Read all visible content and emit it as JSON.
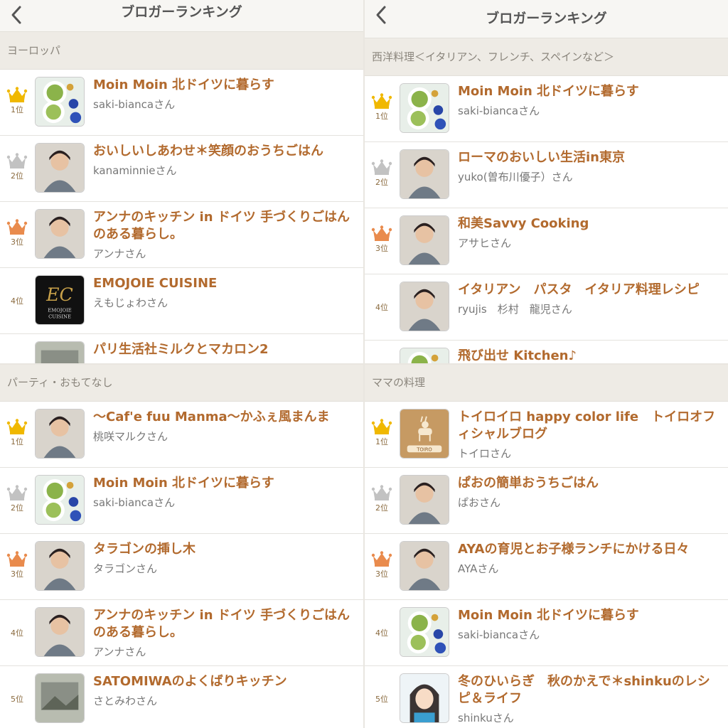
{
  "colors": {
    "gold": "#f0b800",
    "silver": "#c2c2c2",
    "bronze": "#e98b4d",
    "title": "#b26a2e"
  },
  "panels": [
    {
      "header_title": "ブロガーランキング",
      "section": "ヨーロッパ",
      "items": [
        {
          "rank": "1位",
          "medal": "gold",
          "title": "Moin Moin 北ドイツに暮らす",
          "author": "saki-biancaさん",
          "thumb": "food-icon"
        },
        {
          "rank": "2位",
          "medal": "silver",
          "title": "おいしいしあわせ＊笑顔のおうちごはん",
          "author": "kanaminnieさん",
          "thumb": "person-icon"
        },
        {
          "rank": "3位",
          "medal": "bronze",
          "title": "アンナのキッチン in ドイツ 手づくりごはんのある暮らし。",
          "author": "アンナさん",
          "thumb": "person-icon"
        },
        {
          "rank": "4位",
          "medal": "none",
          "title": "EMOJOIE CUISINE",
          "author": "えもじょわさん",
          "thumb": "logo-icon"
        },
        {
          "rank": "",
          "medal": "none",
          "title": "パリ生活社ミルクとマカロン2",
          "author": "",
          "thumb": "photo-icon"
        }
      ]
    },
    {
      "header_title": "ブロガーランキング",
      "section": "西洋料理＜イタリアン、フレンチ、スペインなど＞",
      "items": [
        {
          "rank": "1位",
          "medal": "gold",
          "title": "Moin Moin 北ドイツに暮らす",
          "author": "saki-biancaさん",
          "thumb": "food-icon"
        },
        {
          "rank": "2位",
          "medal": "silver",
          "title": "ローマのおいしい生活in東京",
          "author": "yuko(曽布川優子）さん",
          "thumb": "person-icon"
        },
        {
          "rank": "3位",
          "medal": "bronze",
          "title": "和美Savvy Cooking",
          "author": "アサヒさん",
          "thumb": "person-icon"
        },
        {
          "rank": "4位",
          "medal": "none",
          "title": "イタリアン　パスタ　イタリア料理レシピ",
          "author": "ryujis　杉村　龍児さん",
          "thumb": "person-icon"
        },
        {
          "rank": "",
          "medal": "none",
          "title": "飛び出せ Kitchen♪",
          "author": "",
          "thumb": "food-icon"
        }
      ]
    },
    {
      "header_title": "",
      "section": "パーティ・おもてなし",
      "items": [
        {
          "rank": "1位",
          "medal": "gold",
          "title": "〜Caf'e fuu Manma〜かふぇ風まんま",
          "author": "桃咲マルクさん",
          "thumb": "person-icon"
        },
        {
          "rank": "2位",
          "medal": "silver",
          "title": "Moin Moin 北ドイツに暮らす",
          "author": "saki-biancaさん",
          "thumb": "food-icon"
        },
        {
          "rank": "3位",
          "medal": "bronze",
          "title": "タラゴンの挿し木",
          "author": "タラゴンさん",
          "thumb": "person-icon"
        },
        {
          "rank": "4位",
          "medal": "none",
          "title": "アンナのキッチン in ドイツ 手づくりごはんのある暮らし。",
          "author": "アンナさん",
          "thumb": "person-icon"
        },
        {
          "rank": "5位",
          "medal": "none",
          "title": "SATOMIWAのよくばりキッチン",
          "author": "さとみわさん",
          "thumb": "photo-icon"
        }
      ]
    },
    {
      "header_title": "",
      "section": "ママの料理",
      "items": [
        {
          "rank": "1位",
          "medal": "gold",
          "title": "トイロイロ happy color life　トイロオフィシャルブログ",
          "author": "トイロさん",
          "thumb": "deer-icon"
        },
        {
          "rank": "2位",
          "medal": "silver",
          "title": "ぱおの簡単おうちごはん",
          "author": "ぱおさん",
          "thumb": "person-icon"
        },
        {
          "rank": "3位",
          "medal": "bronze",
          "title": "AYAの育児とお子様ランチにかける日々",
          "author": "AYAさん",
          "thumb": "person-icon"
        },
        {
          "rank": "4位",
          "medal": "none",
          "title": "Moin Moin 北ドイツに暮らす",
          "author": "saki-biancaさん",
          "thumb": "food-icon"
        },
        {
          "rank": "5位",
          "medal": "none",
          "title": "冬のひいらぎ　秋のかえで＊shinkuのレシピ＆ライフ",
          "author": "shinkuさん",
          "thumb": "illustration-icon"
        }
      ]
    }
  ]
}
